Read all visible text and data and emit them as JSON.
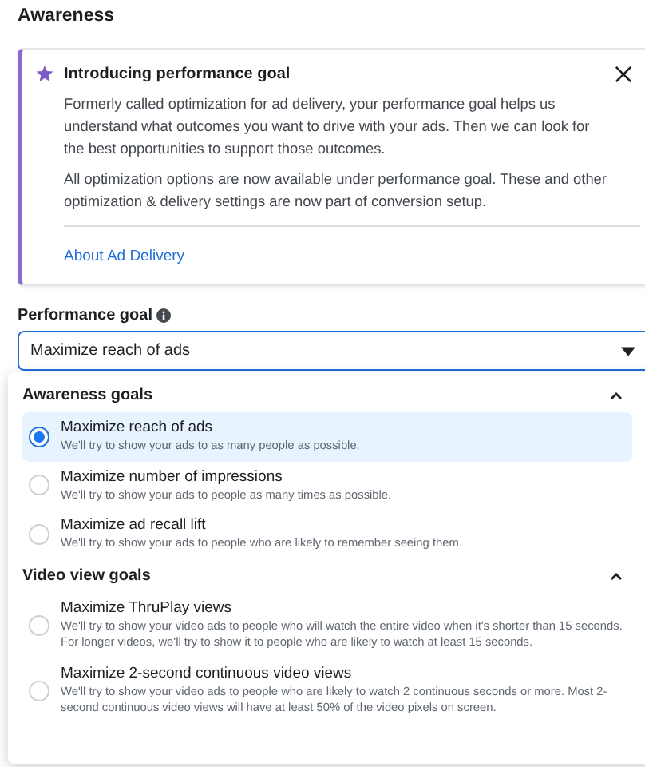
{
  "section_title": "Awareness",
  "notice": {
    "title": "Introducing performance goal",
    "paragraphs": [
      "Formerly called optimization for ad delivery, your performance goal helps us understand what outcomes you want to drive with your ads. Then we can look for the best opportunities to support those outcomes.",
      "All optimization options are now available under performance goal. These and other optimization & delivery settings are now part of conversion setup."
    ],
    "link": "About Ad Delivery"
  },
  "field": {
    "label": "Performance goal",
    "value": "Maximize reach of ads",
    "expanded": true
  },
  "groups": [
    {
      "title": "Awareness goals",
      "expanded": true,
      "options": [
        {
          "title": "Maximize reach of ads",
          "description": "We'll try to show your ads to as many people as possible.",
          "selected": true
        },
        {
          "title": "Maximize number of impressions",
          "description": "We'll try to show your ads to people as many times as possible.",
          "selected": false
        },
        {
          "title": "Maximize ad recall lift",
          "description": "We'll try to show your ads to people who are likely to remember seeing them.",
          "selected": false
        }
      ]
    },
    {
      "title": "Video view goals",
      "expanded": true,
      "options": [
        {
          "title": "Maximize ThruPlay views",
          "description": "We'll try to show your video ads to people who will watch the entire video when it's shorter than 15 seconds. For longer videos, we'll try to show it to people who are likely to watch at least 15 seconds.",
          "selected": false
        },
        {
          "title": "Maximize 2-second continuous video views",
          "description": "We'll try to show your video ads to people who are likely to watch 2 continuous seconds or more. Most 2-second continuous video views will have at least 50% of the video pixels on screen.",
          "selected": false
        }
      ]
    }
  ]
}
